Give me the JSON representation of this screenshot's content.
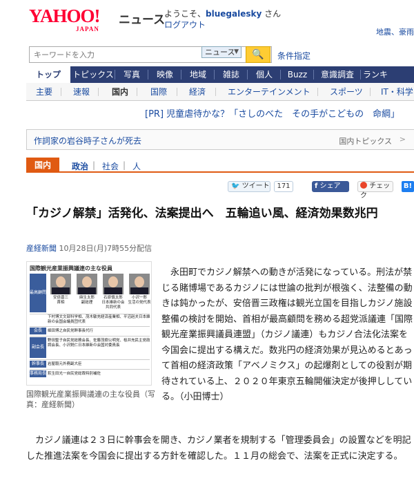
{
  "header": {
    "logo_main": "YAHOO!",
    "logo_sub": "JAPAN",
    "section": "ニュース",
    "welcome_prefix": "ようこそ、",
    "username": "bluegalesky",
    "welcome_suffix": " さん",
    "logout": "ログアウト",
    "top_links": "地震、豪雨"
  },
  "search": {
    "placeholder": "キーワードを入力",
    "category": "ニュース",
    "advanced": "条件指定"
  },
  "main_nav": [
    "トップ",
    "トピックス",
    "写真",
    "映像",
    "地域",
    "雑誌",
    "個人",
    "Buzz",
    "意識調査",
    "ランキ"
  ],
  "sub_nav": [
    "主要",
    "速報",
    "国内",
    "国際",
    "経済",
    "エンターテインメント",
    "スポーツ",
    "IT・科学"
  ],
  "pr": "[PR] 児童虐待かな？「さしのべた　その手がこどもの　命綱」",
  "topic_bar": {
    "headline": "作詞家の岩谷時子さんが死去",
    "label": "国内トピックス"
  },
  "category_tabs": {
    "active": "国内",
    "items": [
      "政治",
      "社会",
      "人"
    ]
  },
  "social": {
    "tweet": "ツイート",
    "tweet_count": "171",
    "share": "シェア",
    "check": "チェック",
    "hatena": "B!"
  },
  "article": {
    "headline": "「カジノ解禁」活発化、法案提出へ　五輪追い風、経済効果数兆円",
    "source": "産経新聞",
    "datetime": "10月28日(月)7時55分配信",
    "caption": "国際観光産業振興議連の主な役員（写真：産経新聞）",
    "para1": "永田町でカジノ解禁への動きが活発になっている。刑法が禁じる賭博場であるカジノには世論の批判が根強く、法整備の動きは鈍かったが、安倍晋三政権は観光立国を目指しカジノ施設整備の検討を開始、首相が最高顧問を務める超党派議連「国際観光産業振興議員連盟」（カジノ議連）もカジノ合法化法案を今国会に提出する構えだ。数兆円の経済効果が見込めるとあって首相の経済政策「アベノミクス」の起爆剤としての役割が期待されている上、２０２０年東京五輪開催決定が後押ししている。（小田博士）",
    "para2": "カジノ議連は２３日に幹事会を開き、カジノ業者を規制する「管理委員会」の設置などを明記した推進法案を今国会に提出する方針を確認した。１１月の総会で、法案を正式に決定する。"
  },
  "figure": {
    "title": "国際観光産業振興議連の主な役員",
    "advisors_label": "最高顧問",
    "people": [
      {
        "name": "安倍晋三",
        "role": "首相"
      },
      {
        "name": "麻生太郎",
        "role": "副総理"
      },
      {
        "name": "石原慎太郎",
        "role": "日本維新の会共同代表"
      },
      {
        "name": "小沢一郎",
        "role": "生活の党代表"
      }
    ],
    "rows": [
      {
        "label": "会長",
        "text": "細田博之自民党幹事長代行"
      },
      {
        "label": "副会長",
        "text": "野田聖子自民党総務会長、佐藤茂樹公明党、桜井充民主党政調会長、小沢鋭仁日本維新の会国対委員長"
      },
      {
        "label": "幹事長",
        "text": "岩屋毅元外務副大臣"
      },
      {
        "label": "事務局長",
        "text": "萩生田光一自民党総裁特別補佐"
      }
    ],
    "extra": "下村博文文部科学相、茂木敏充経済産業相、平沼赳夫日本維新の会国会議員団代表"
  }
}
